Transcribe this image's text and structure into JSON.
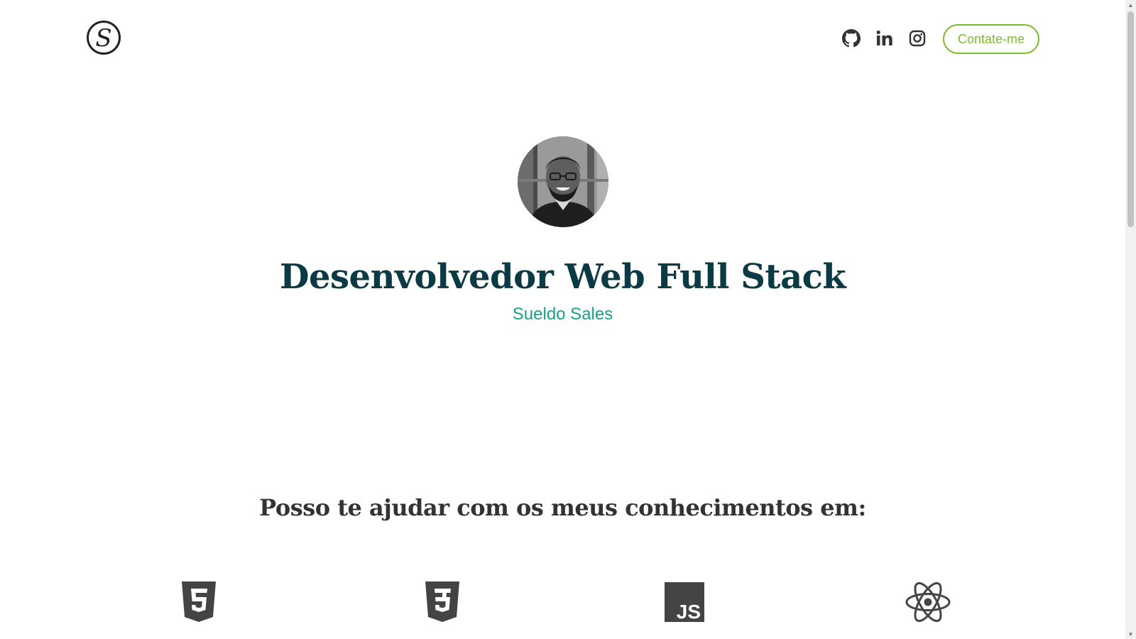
{
  "header": {
    "logo_letter": "S",
    "social": [
      {
        "name": "github",
        "icon": "github-icon"
      },
      {
        "name": "linkedin",
        "icon": "linkedin-icon"
      },
      {
        "name": "instagram",
        "icon": "instagram-icon"
      }
    ],
    "contact_label": "Contate-me"
  },
  "hero": {
    "title": "Desenvolvedor Web Full Stack",
    "subtitle": "Sueldo Sales"
  },
  "skills": {
    "title": "Posso te ajudar com os meus conhecimentos em:",
    "items": [
      {
        "name": "html5",
        "icon": "html5-icon"
      },
      {
        "name": "css3",
        "icon": "css3-icon"
      },
      {
        "name": "javascript",
        "icon": "javascript-icon",
        "label": "JS"
      },
      {
        "name": "react",
        "icon": "react-icon"
      }
    ]
  },
  "colors": {
    "accent_green": "#7cbd2a",
    "title_dark": "#0b3a45",
    "subtitle_teal": "#1aa086",
    "icon_gray": "#444444"
  }
}
